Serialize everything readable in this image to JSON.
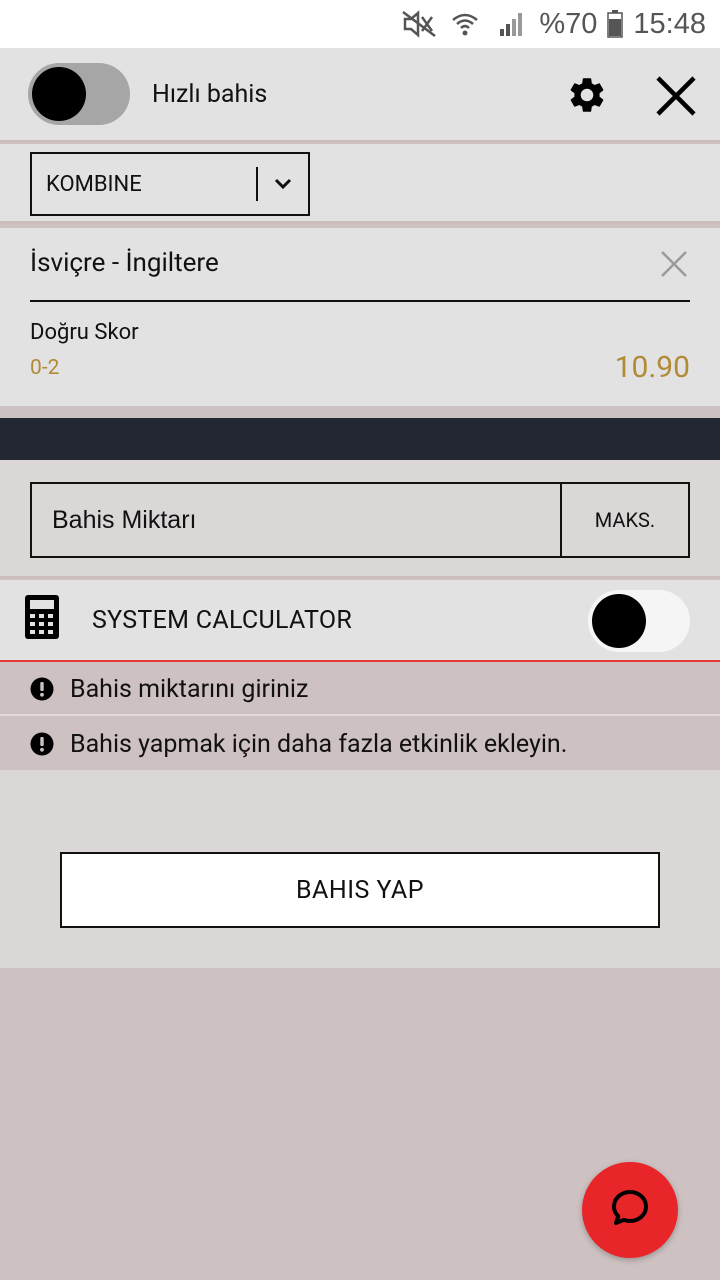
{
  "status_bar": {
    "battery_text": "%70",
    "time": "15:48",
    "icons": [
      "mute-icon",
      "wifi-icon",
      "signal-icon",
      "battery-icon"
    ]
  },
  "header": {
    "quick_bet_label": "Hızlı bahis",
    "quick_bet_on": false,
    "settings_icon": "gear-icon",
    "close_icon": "close-icon"
  },
  "bet_type": {
    "selected": "KOMBINE"
  },
  "selection": {
    "match": "İsviçre - İngiltere",
    "market": "Doğru Skor",
    "pick": "0-2",
    "odds": "10.90"
  },
  "stake": {
    "placeholder": "Bahis Miktarı",
    "max_label": "MAKS."
  },
  "system_calculator": {
    "label": "SYSTEM CALCULATOR",
    "enabled": false
  },
  "warnings": [
    {
      "text": "Bahis miktarını giriniz"
    },
    {
      "text": "Bahis yapmak için daha fazla etkinlik ekleyin."
    }
  ],
  "actions": {
    "place_bet_label": "BAHIS YAP"
  },
  "colors": {
    "accent_gold": "#b38a35",
    "error_red": "#e53935",
    "fab_red": "#e8262a",
    "dark_band": "#222733"
  }
}
